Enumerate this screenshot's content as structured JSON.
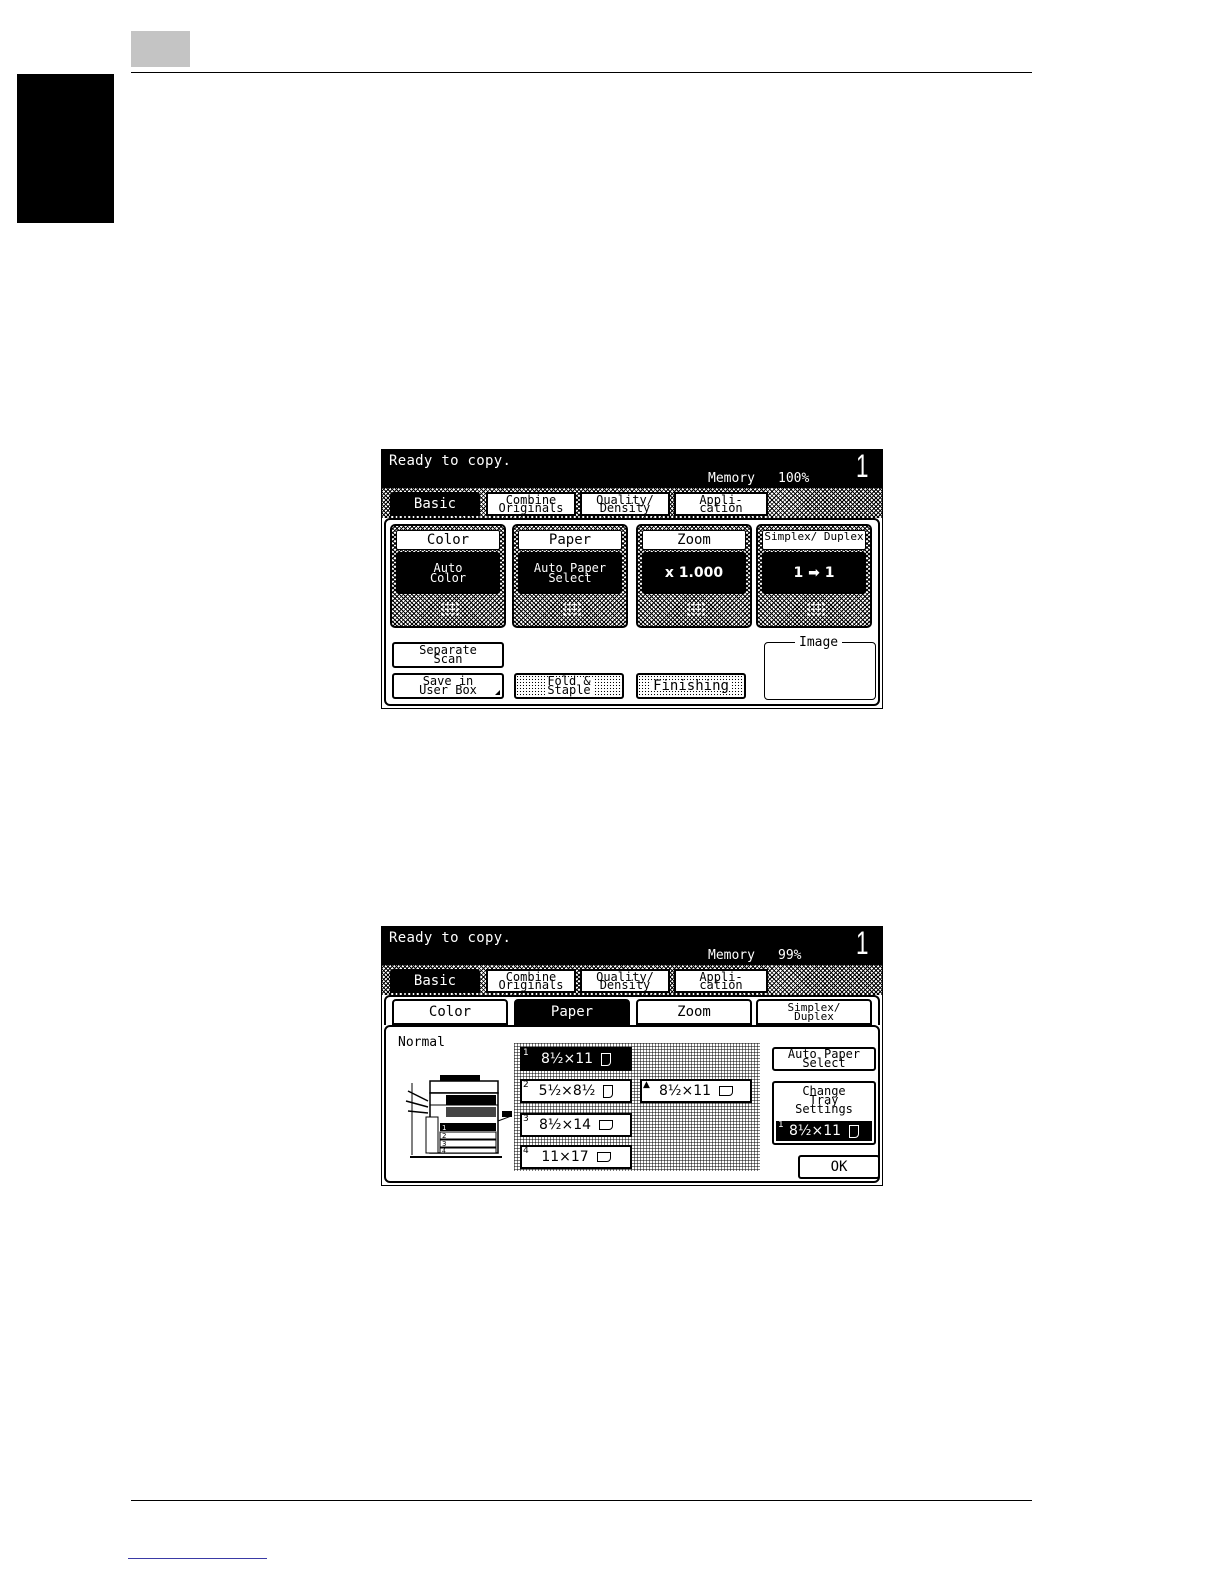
{
  "screen1": {
    "status": "Ready to copy.",
    "memory_label": "Memory",
    "memory_value": "100%",
    "copy_count": "1",
    "tabs": [
      {
        "label": "Basic"
      },
      {
        "label": "Combine\nOriginals"
      },
      {
        "label": "Quality/\nDensity"
      },
      {
        "label": "Appli-\ncation"
      }
    ],
    "functions": [
      {
        "title": "Color",
        "value": "Auto\nColor"
      },
      {
        "title": "Paper",
        "value": "Auto Paper\nSelect"
      },
      {
        "title": "Zoom",
        "value": "x 1.000"
      },
      {
        "title": "Simplex/\nDuplex",
        "value": "1 ➡ 1"
      }
    ],
    "buttons": {
      "separate_scan": "Separate\nScan",
      "save_user_box": "Save in\nUser Box",
      "fold_staple": "Fold &\nStaple",
      "finishing": "Finishing",
      "image": "Image"
    }
  },
  "screen2": {
    "status": "Ready to copy.",
    "memory_label": "Memory",
    "memory_value": "99%",
    "copy_count": "1",
    "tabs": [
      {
        "label": "Basic"
      },
      {
        "label": "Combine\nOriginals"
      },
      {
        "label": "Quality/\nDensity"
      },
      {
        "label": "Appli-\ncation"
      }
    ],
    "subtabs": [
      {
        "label": "Color"
      },
      {
        "label": "Paper"
      },
      {
        "label": "Zoom"
      },
      {
        "label": "Simplex/\nDuplex"
      }
    ],
    "normal_label": "Normal",
    "trays": [
      {
        "num": "1",
        "size": "8½×11"
      },
      {
        "num": "2",
        "size": "5½×8½"
      },
      {
        "num": "3",
        "size": "8½×14"
      },
      {
        "num": "4",
        "size": "11×17"
      },
      {
        "num": "▲",
        "size": "8½×11"
      }
    ],
    "buttons": {
      "auto_paper_select": "Auto Paper\nSelect",
      "change_tray_settings": "Change\nTray\nSettings",
      "current_tray_num": "1",
      "current_tray_size": "8½×11",
      "ok": "OK"
    },
    "machine_tray_labels": [
      "1",
      "2",
      "3",
      "4"
    ]
  }
}
